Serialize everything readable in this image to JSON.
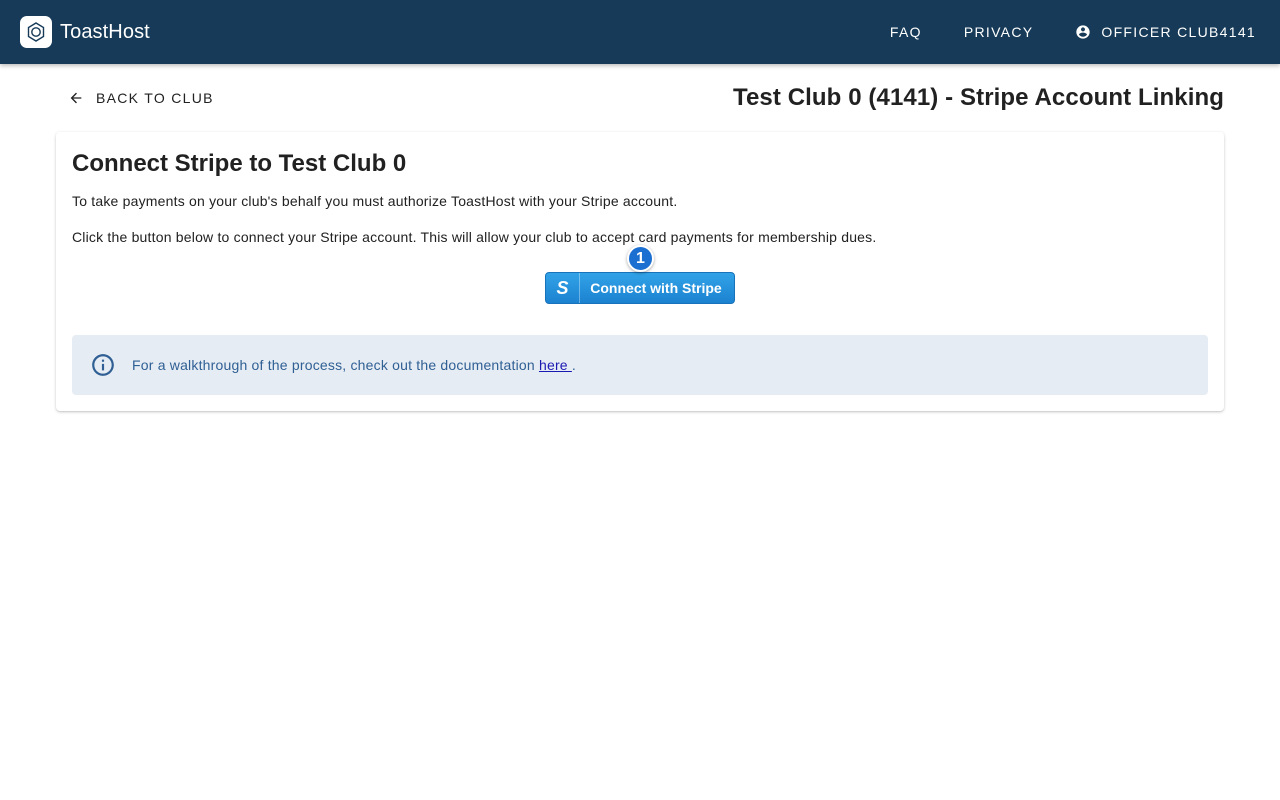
{
  "app": {
    "name": "ToastHost",
    "logo_icon": "toasthost-logo-icon"
  },
  "nav": {
    "items": [
      {
        "label": "FAQ"
      },
      {
        "label": "PRIVACY"
      }
    ],
    "user": {
      "label": "OFFICER CLUB4141",
      "icon": "account-circle-icon"
    }
  },
  "header": {
    "back_label": "BACK TO CLUB",
    "back_icon": "arrow-left-icon",
    "title": "Test Club 0 (4141) - Stripe Account Linking"
  },
  "card": {
    "title": "Connect Stripe to Test Club 0",
    "paragraph1": "To take payments on your club's behalf you must authorize ToastHost with your Stripe account.",
    "paragraph2": "Click the button below to connect your Stripe account. This will allow your club to accept card payments for membership dues.",
    "stripe_button": {
      "glyph": "S",
      "label": "Connect with Stripe",
      "color": "#1c82d0"
    },
    "badge": "1",
    "info": {
      "icon": "info-icon",
      "text_before": "For a walkthrough of the process, check out the documentation ",
      "link_label": "here ",
      "text_after": "."
    }
  },
  "colors": {
    "appbar": "#163a57",
    "alert_bg": "#e6ecf3",
    "alert_text": "#2f5f94"
  }
}
